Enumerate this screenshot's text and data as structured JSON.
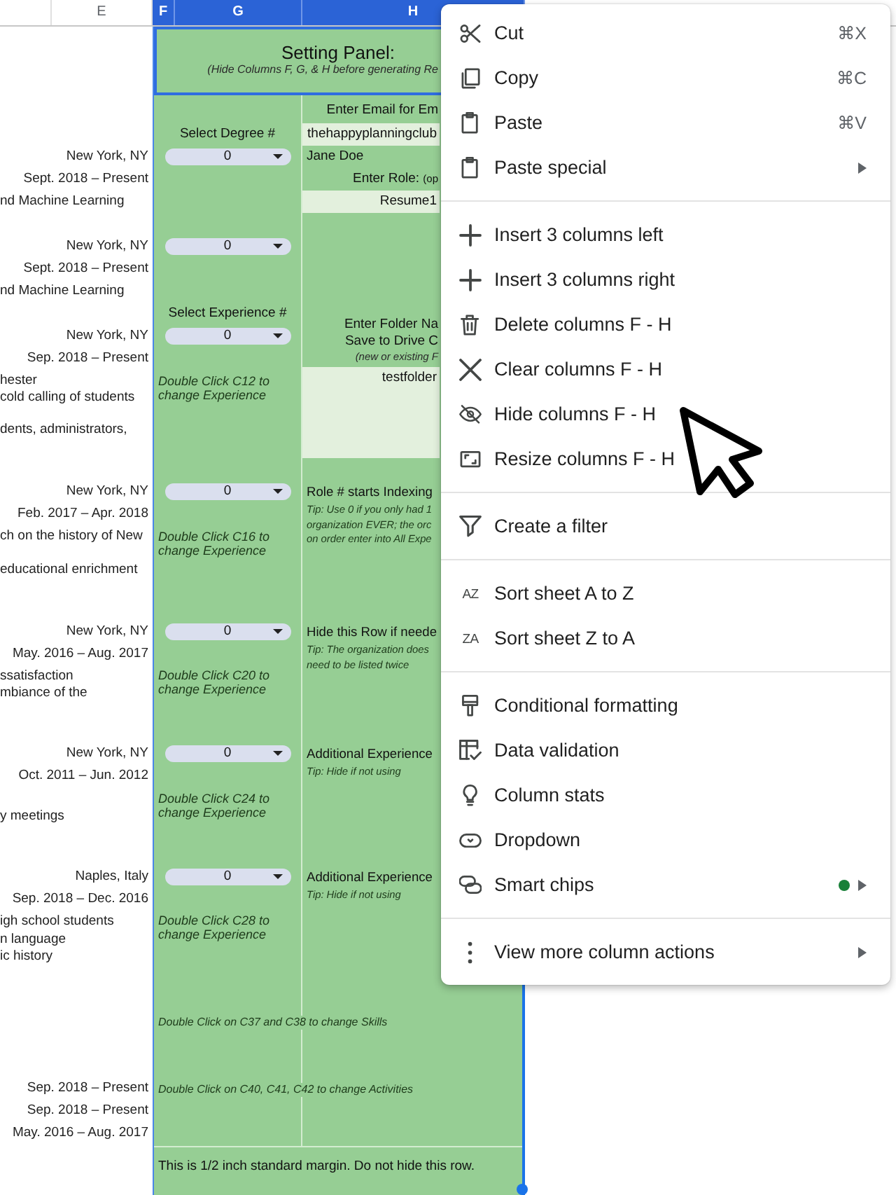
{
  "column_headers": [
    {
      "label": "E",
      "selected": false
    },
    {
      "label": "F",
      "selected": true
    },
    {
      "label": "G",
      "selected": true
    },
    {
      "label": "H",
      "selected": true
    }
  ],
  "left_column": [
    {
      "kind": "place",
      "text": "New York, NY"
    },
    {
      "kind": "dates",
      "text": "Sept. 2018 – Present"
    },
    {
      "kind": "overflow",
      "text": "nd Machine Learning"
    },
    {
      "kind": "place",
      "text": "New York, NY"
    },
    {
      "kind": "dates",
      "text": "Sept. 2018 – Present"
    },
    {
      "kind": "overflow",
      "text": "nd Machine Learning"
    },
    {
      "kind": "place",
      "text": "New York, NY"
    },
    {
      "kind": "dates",
      "text": "Sep. 2018 – Present"
    },
    {
      "kind": "overflow",
      "text": "hester"
    },
    {
      "kind": "overflow",
      "text": "cold calling of students"
    },
    {
      "kind": "overflow",
      "text": "dents, administrators,"
    },
    {
      "kind": "place",
      "text": "New York, NY"
    },
    {
      "kind": "dates",
      "text": "Feb. 2017 – Apr. 2018"
    },
    {
      "kind": "overflow",
      "text": "ch on the history of New"
    },
    {
      "kind": "overflow",
      "text": "educational enrichment"
    },
    {
      "kind": "place",
      "text": "New York, NY"
    },
    {
      "kind": "dates",
      "text": "May. 2016 – Aug. 2017"
    },
    {
      "kind": "overflow",
      "text": "ssatisfaction"
    },
    {
      "kind": "overflow",
      "text": "mbiance of the"
    },
    {
      "kind": "place",
      "text": "New York, NY"
    },
    {
      "kind": "dates",
      "text": "Oct. 2011 – Jun. 2012"
    },
    {
      "kind": "overflow",
      "text": "y meetings"
    },
    {
      "kind": "place",
      "text": "Naples, Italy"
    },
    {
      "kind": "dates",
      "text": "Sep. 2018 – Dec. 2016"
    },
    {
      "kind": "overflow",
      "text": "igh school students"
    },
    {
      "kind": "overflow",
      "text": "n language"
    },
    {
      "kind": "overflow",
      "text": "ic history"
    },
    {
      "kind": "dates",
      "text": "Sep. 2018 – Present"
    },
    {
      "kind": "dates",
      "text": "Sep. 2018 – Present"
    },
    {
      "kind": "dates",
      "text": "May. 2016 – Aug. 2017"
    }
  ],
  "setting_panel": {
    "title": "Setting Panel:",
    "subtitle": "(Hide Columns F, G, & H before generating Re"
  },
  "column_g": [
    {
      "kind": "label",
      "text": "Select Degree #"
    },
    {
      "kind": "dropdown",
      "value": "0"
    },
    {
      "kind": "dropdown",
      "value": "0"
    },
    {
      "kind": "label",
      "text": "Select Experience #"
    },
    {
      "kind": "dropdown",
      "value": "0"
    },
    {
      "kind": "note",
      "text": "Double Click C12 to change Experience"
    },
    {
      "kind": "dropdown",
      "value": "0"
    },
    {
      "kind": "note",
      "text": "Double Click C16 to change Experience"
    },
    {
      "kind": "dropdown",
      "value": "0"
    },
    {
      "kind": "note",
      "text": "Double Click C20 to change Experience"
    },
    {
      "kind": "dropdown",
      "value": "0"
    },
    {
      "kind": "note",
      "text": "Double Click C24 to change Experience"
    },
    {
      "kind": "dropdown",
      "value": "0"
    },
    {
      "kind": "note",
      "text": "Double Click C28 to change Experience"
    },
    {
      "kind": "wide",
      "text": "Double Click on C37 and C38 to change Skills"
    },
    {
      "kind": "wide",
      "text": "Double Click on C40, C41, C42 to change Activities"
    }
  ],
  "column_h": [
    {
      "kind": "heading",
      "lines": [
        "Enter Email for Em"
      ]
    },
    {
      "kind": "field",
      "value": "thehappyplanningclub"
    },
    {
      "kind": "text",
      "text": "Jane Doe"
    },
    {
      "kind": "prompt",
      "text": "Enter Role:",
      "hint": "(op"
    },
    {
      "kind": "field",
      "value": "Resume1"
    },
    {
      "kind": "heading",
      "lines": [
        "Enter Folder Na",
        "Save to Drive C"
      ],
      "note": "(new or existing F"
    },
    {
      "kind": "field",
      "value": "testfolder"
    },
    {
      "kind": "block",
      "title": "Role # starts Indexing",
      "tip": [
        "Tip: Use 0 if you only had 1",
        "organization EVER; the orc",
        "on order enter into All Expe"
      ]
    },
    {
      "kind": "block",
      "title": "Hide this Row if neede",
      "tip": [
        "Tip: The organization does",
        "need to be listed twice"
      ]
    },
    {
      "kind": "block",
      "title": "Additional Experience",
      "tip": [
        "Tip: Hide if not using"
      ]
    },
    {
      "kind": "block",
      "title": "Additional Experience",
      "tip": [
        "Tip: Hide if not using"
      ]
    }
  ],
  "margin_row": {
    "text": "This is 1/2 inch standard margin. Do not hide this row."
  },
  "context_menu": {
    "sections": [
      [
        {
          "label": "Cut",
          "shortcut": "⌘X",
          "submenu": false,
          "dot": false
        },
        {
          "label": "Copy",
          "shortcut": "⌘C",
          "submenu": false,
          "dot": false
        },
        {
          "label": "Paste",
          "shortcut": "⌘V",
          "submenu": false,
          "dot": false
        },
        {
          "label": "Paste special",
          "submenu": true,
          "dot": false
        }
      ],
      [
        {
          "label": "Insert 3 columns left",
          "submenu": false,
          "dot": false
        },
        {
          "label": "Insert 3 columns right",
          "submenu": false,
          "dot": false
        },
        {
          "label": "Delete columns F - H",
          "submenu": false,
          "dot": false
        },
        {
          "label": "Clear columns F - H",
          "submenu": false,
          "dot": false
        },
        {
          "label": "Hide columns F - H",
          "submenu": false,
          "dot": false
        },
        {
          "label": "Resize columns F - H",
          "submenu": false,
          "dot": false
        }
      ],
      [
        {
          "label": "Create a filter",
          "submenu": false,
          "dot": false
        }
      ],
      [
        {
          "label": "Sort sheet A to Z",
          "glyph": "AZ",
          "submenu": false,
          "dot": false
        },
        {
          "label": "Sort sheet Z to A",
          "glyph": "ZA",
          "submenu": false,
          "dot": false
        }
      ],
      [
        {
          "label": "Conditional formatting",
          "submenu": false,
          "dot": false
        },
        {
          "label": "Data validation",
          "submenu": false,
          "dot": false
        },
        {
          "label": "Column stats",
          "submenu": false,
          "dot": false
        },
        {
          "label": "Dropdown",
          "submenu": false,
          "dot": false
        },
        {
          "label": "Smart chips",
          "submenu": true,
          "dot": true
        }
      ],
      [
        {
          "label": "View more column actions",
          "submenu": true,
          "dot": false
        }
      ]
    ]
  }
}
